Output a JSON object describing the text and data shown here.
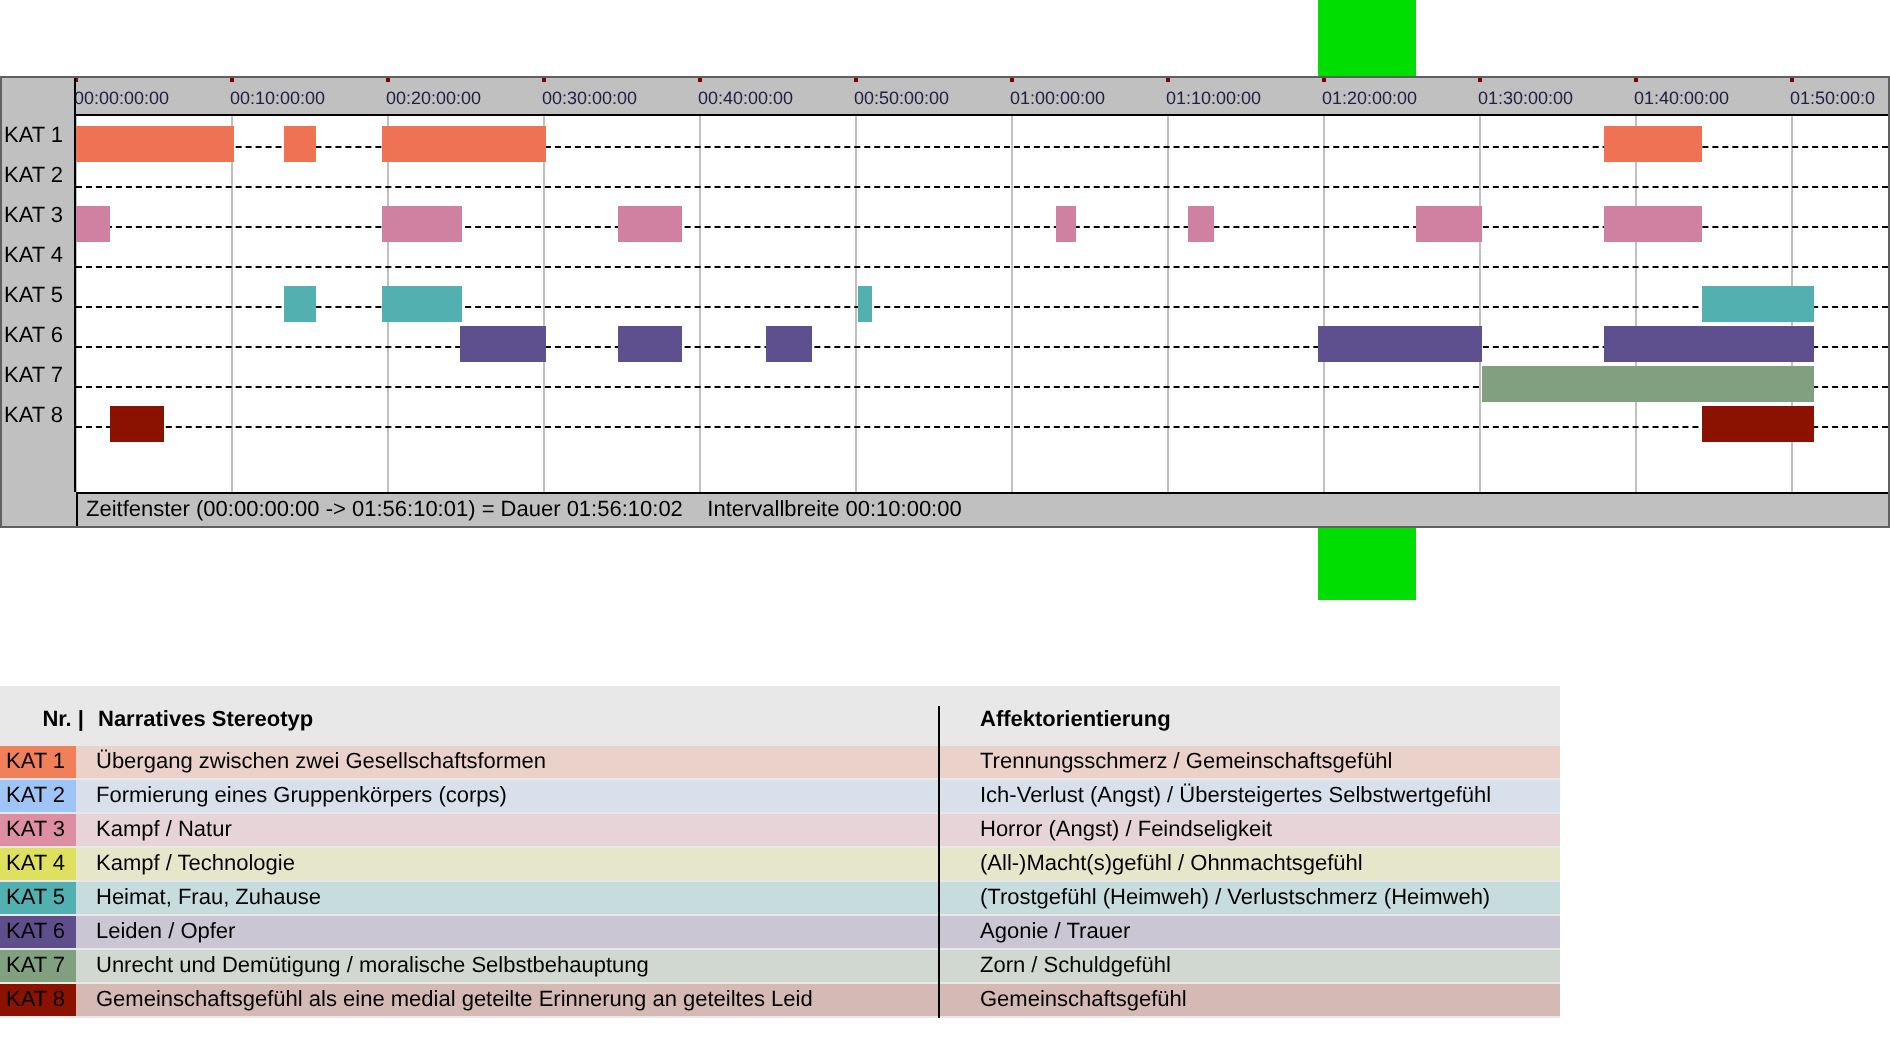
{
  "timeline": {
    "time_labels": [
      "00:00:00:00",
      "00:10:00:00",
      "00:20:00:00",
      "00:30:00:00",
      "00:40:00:00",
      "00:50:00:00",
      "01:00:00:00",
      "01:10:00:00",
      "01:20:00:00",
      "01:30:00:00",
      "01:40:00:00",
      "01:50:00:0"
    ],
    "tracks": [
      {
        "label": "KAT 1",
        "color": "#f07254"
      },
      {
        "label": "KAT 2"
      },
      {
        "label": "KAT 3",
        "color": "#d080a0"
      },
      {
        "label": "KAT 4"
      },
      {
        "label": "KAT 5",
        "color": "#52b0b0"
      },
      {
        "label": "KAT 6",
        "color": "#5e508e"
      },
      {
        "label": "KAT 7",
        "color": "#80a080"
      },
      {
        "label": "KAT 8",
        "color": "#8c1200"
      }
    ],
    "status": "Zeitfenster (00:00:00:00 -> 01:56:10:01) = Dauer 01:56:10:02    Intervallbreite 00:10:00:00"
  },
  "legend": {
    "columns": [
      "Nr. |",
      "Narratives Stereotyp",
      "Affektorientierung"
    ],
    "rows": [
      {
        "label": "KAT 1",
        "color": "#f07f5a",
        "stereotype": "Übergang zwischen zwei Gesellschaftsformen",
        "affect": "Trennungsschmerz / Gemeinschaftsgefühl"
      },
      {
        "label": "KAT 2",
        "color": "#9ec5f5",
        "stereotype": "Formierung eines Gruppenkörpers (corps)",
        "affect": "Ich-Verlust (Angst) / Übersteigertes Selbstwertgefühl"
      },
      {
        "label": "KAT 3",
        "color": "#dd8ea2",
        "stereotype": "Kampf / Natur",
        "affect": "Horror (Angst) / Feindseligkeit"
      },
      {
        "label": "KAT 4",
        "color": "#e0e060",
        "stereotype": "Kampf / Technologie",
        "affect": "(All-)Macht(s)gefühl / Ohnmachtsgefühl"
      },
      {
        "label": "KAT 5",
        "color": "#52b0b0",
        "stereotype": "Heimat, Frau, Zuhause",
        "affect": "(Trostgefühl (Heimweh) / Verlustschmerz (Heimweh)"
      },
      {
        "label": "KAT 6",
        "color": "#5e4f8c",
        "stereotype": "Leiden / Opfer",
        "affect": "Agonie / Trauer"
      },
      {
        "label": "KAT 7",
        "color": "#80a080",
        "stereotype": "Unrecht und Demütigung / moralische Selbstbehauptung",
        "affect": "Zorn / Schuldgefühl"
      },
      {
        "label": "KAT 8",
        "color": "#8c1200",
        "stereotype": "Gemeinschaftsgefühl als eine medial geteilte Erinnerung an geteiltes Leid",
        "affect": "Gemeinschaftsgefühl"
      }
    ]
  }
}
